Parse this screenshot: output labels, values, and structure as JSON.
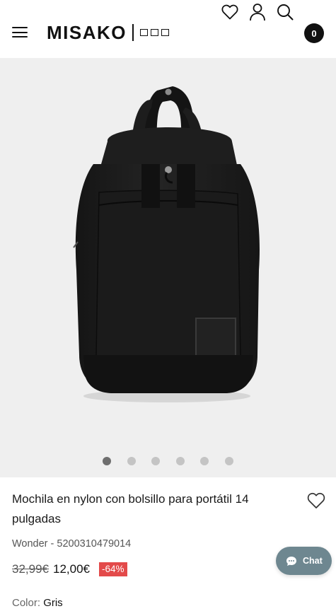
{
  "header": {
    "logo_text": "MISAKO",
    "cart_count": "0",
    "icons": [
      "menu-icon",
      "heart-icon",
      "user-icon",
      "search-icon"
    ]
  },
  "gallery": {
    "image_subject": "black nylon backpack",
    "slide_count": 6,
    "active_slide": 1
  },
  "product": {
    "title": "Mochila en nylon con bolsillo para portátil 14 pulgadas",
    "meta": "Wonder - 5200310479014",
    "old_price": "32,99€",
    "price": "12,00€",
    "discount": "-64%",
    "color_label": "Color:",
    "color_value": "Gris"
  },
  "chat": {
    "label": "Chat"
  },
  "colors": {
    "discount_bg": "#e34a4a",
    "chat_bg": "#6e8790",
    "gallery_bg": "#efefef"
  }
}
